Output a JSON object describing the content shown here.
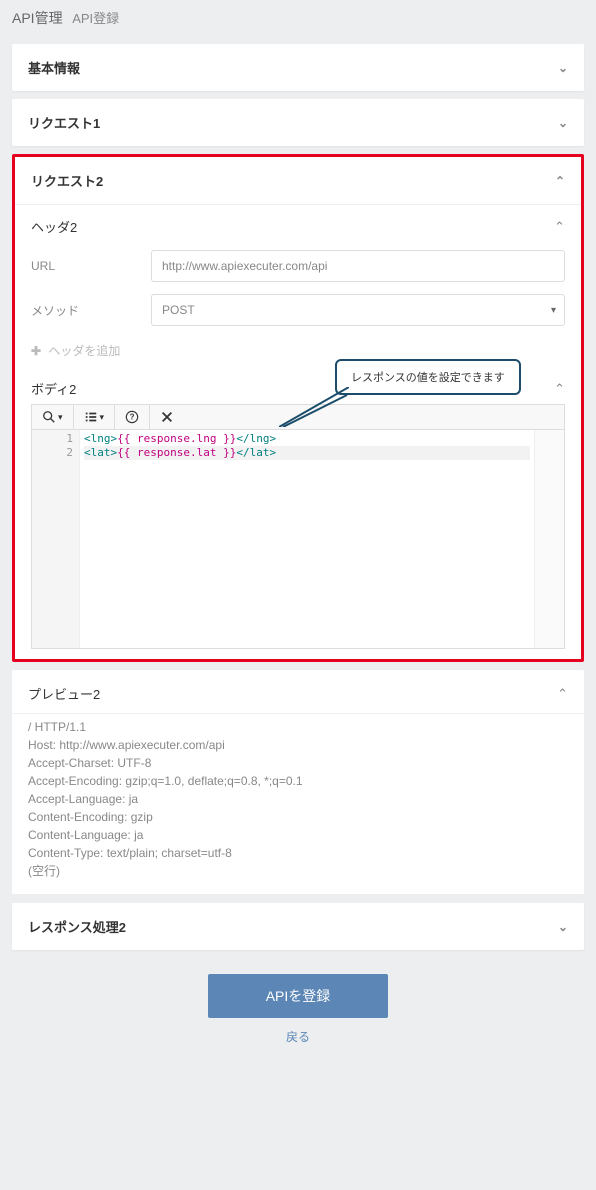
{
  "breadcrumb": {
    "main": "API管理",
    "sub": "API登録"
  },
  "panels": {
    "basic": {
      "title": "基本情報"
    },
    "request1": {
      "title": "リクエスト1"
    },
    "request2": {
      "title": "リクエスト2",
      "header2": {
        "title": "ヘッダ2",
        "url_label": "URL",
        "url_value": "http://www.apiexecuter.com/api",
        "method_label": "メソッド",
        "method_value": "POST",
        "add_header": "ヘッダを追加"
      },
      "body2": {
        "title": "ボディ2",
        "callout": "レスポンスの値を設定できます",
        "lines": [
          {
            "n": "1",
            "open": "<lng>",
            "mid": "{{ response.lng }}",
            "close": "</lng>"
          },
          {
            "n": "2",
            "open": "<lat>",
            "mid": "{{ response.lat }}",
            "close": "</lat>"
          }
        ]
      }
    },
    "preview2": {
      "title": "プレビュー2",
      "lines": [
        "/ HTTP/1.1",
        "Host: http://www.apiexecuter.com/api",
        "Accept-Charset: UTF-8",
        "Accept-Encoding: gzip;q=1.0, deflate;q=0.8, *;q=0.1",
        "Accept-Language: ja",
        "Content-Encoding: gzip",
        "Content-Language: ja",
        "Content-Type: text/plain; charset=utf-8",
        "(空行)"
      ]
    },
    "response2": {
      "title": "レスポンス処理2"
    }
  },
  "actions": {
    "submit": "APIを登録",
    "back": "戻る"
  }
}
